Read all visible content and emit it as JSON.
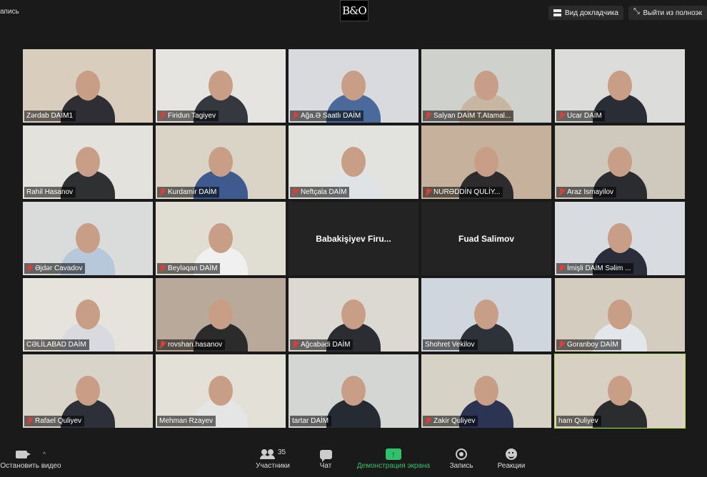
{
  "topbar": {
    "recording_label": "апись",
    "logo": "B&O",
    "view_button": "Вид докладчика",
    "exit_button": "Выйти из полноэк"
  },
  "participants": [
    {
      "name": "Zərdab DAİM1",
      "muted": false,
      "wall": "#d9cdbd",
      "suit": "#2e2e34",
      "blank": false
    },
    {
      "name": "Firidun Tagiyev",
      "muted": true,
      "wall": "#e6e4e0",
      "suit": "#35393f",
      "blank": false
    },
    {
      "name": "Ağa.Ə Saatlı DAİM",
      "muted": true,
      "wall": "#d8dadd",
      "suit": "#4a6a9c",
      "blank": false
    },
    {
      "name": "Salyan DAİM T.Atamal...",
      "muted": true,
      "wall": "#cfd1cd",
      "suit": "#c7b6a1",
      "blank": false
    },
    {
      "name": "Ucar DAİM",
      "muted": true,
      "wall": "#dcdcda",
      "suit": "#2b2d36",
      "blank": false
    },
    {
      "name": "Rahil Hasanov",
      "muted": false,
      "wall": "#e4e2dc",
      "suit": "#2f3032",
      "blank": false
    },
    {
      "name": "Kurdamir DAİM",
      "muted": true,
      "wall": "#dad4c6",
      "suit": "#3e5a8f",
      "blank": false
    },
    {
      "name": "Neftçala DAİM",
      "muted": true,
      "wall": "#e2e2df",
      "suit": "#dfe3e6",
      "blank": false
    },
    {
      "name": "NURƏDDİN QULİY...",
      "muted": true,
      "wall": "#c6b29c",
      "suit": "#2c2b2d",
      "blank": false
    },
    {
      "name": "Araz Ismayilov",
      "muted": true,
      "wall": "#cfc9bd",
      "suit": "#2a2c30",
      "blank": false
    },
    {
      "name": "Əjdər Cavadov",
      "muted": true,
      "wall": "#d9dcdb",
      "suit": "#b7c8db",
      "blank": false
    },
    {
      "name": "Beyləqan DAİM",
      "muted": true,
      "wall": "#e0ddd2",
      "suit": "#f0f0f0",
      "blank": false
    },
    {
      "name": "Babakişiyev  Firu...",
      "muted": false,
      "wall": "#232323",
      "suit": "#232323",
      "blank": true
    },
    {
      "name": "Fuad Salimov",
      "muted": false,
      "wall": "#232323",
      "suit": "#232323",
      "blank": true
    },
    {
      "name": "İmişli DAİM Səlim ...",
      "muted": true,
      "wall": "#d8dbe0",
      "suit": "#2b2e3a",
      "blank": false
    },
    {
      "name": "CƏLİLABAD DAİM",
      "muted": false,
      "wall": "#e5e3dc",
      "suit": "#d8dadf",
      "blank": false
    },
    {
      "name": "rovshan.hasanov",
      "muted": true,
      "wall": "#b9a99a",
      "suit": "#2b2b2b",
      "blank": false
    },
    {
      "name": "Ağcabədi DAİM",
      "muted": true,
      "wall": "#dcd9d3",
      "suit": "#2c2d33",
      "blank": false
    },
    {
      "name": "Shohret Vekilov",
      "muted": false,
      "wall": "#cfd6dd",
      "suit": "#2d323a",
      "blank": false
    },
    {
      "name": "Goranboy DAİM",
      "muted": true,
      "wall": "#d4ccbf",
      "suit": "#e3e6ea",
      "blank": false
    },
    {
      "name": "Rafael Quliyev",
      "muted": true,
      "wall": "#d9d4c9",
      "suit": "#2d3038",
      "blank": false
    },
    {
      "name": "Mehman Rzayev",
      "muted": false,
      "wall": "#e3e0d8",
      "suit": "#e5e5e5",
      "blank": false
    },
    {
      "name": "tartar DAİM",
      "muted": false,
      "wall": "#d3d6d3",
      "suit": "#262a33",
      "blank": false
    },
    {
      "name": "Zakir Quliyev",
      "muted": true,
      "wall": "#d6d2c6",
      "suit": "#2b3452",
      "blank": false
    },
    {
      "name": "ham Quliyev",
      "muted": false,
      "wall": "#d7d0c3",
      "suit": "#2b2c2e",
      "blank": false,
      "active": true
    }
  ],
  "toolbar": {
    "video_label": "Остановить видео",
    "participants_label": "Участники",
    "participants_count": "35",
    "chat_label": "Чат",
    "share_label": "Демонстрация экрана",
    "record_label": "Запись",
    "reactions_label": "Реакции"
  },
  "colors": {
    "background": "#1a1a1a",
    "active_speaker_border": "#b3e33c",
    "share_green": "#2ec36b",
    "muted_red": "#e23b3b"
  }
}
